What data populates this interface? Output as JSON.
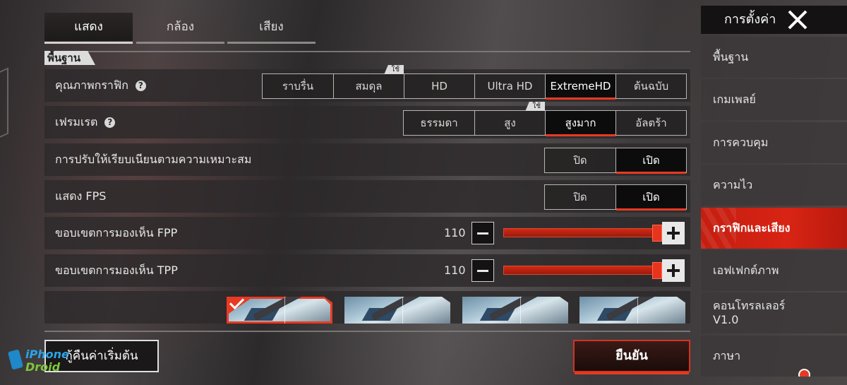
{
  "tabs": [
    {
      "label": "แสดง",
      "active": true
    },
    {
      "label": "กล้อง",
      "active": false
    },
    {
      "label": "เสียง",
      "active": false
    }
  ],
  "section": {
    "title": "พื้นฐาน"
  },
  "graphics_quality": {
    "label": "คุณภาพกราฟิก",
    "recommended_badge": "ใช้",
    "options": [
      "ราบรื่น",
      "สมดุล",
      "HD",
      "Ultra HD",
      "ExtremeHD",
      "ต้นฉบับ"
    ],
    "selected": "ExtremeHD",
    "recommended": "สมดุล"
  },
  "frame_rate": {
    "label": "เฟรมเรต",
    "recommended_badge": "ใช้",
    "options": [
      "ธรรมดา",
      "สูง",
      "สูงมาก",
      "อัลตร้า"
    ],
    "selected": "สูงมาก",
    "recommended": "สูง"
  },
  "adaptive_smooth": {
    "label": "การปรับให้เรียบเนียนตามความเหมาะสม",
    "off": "ปิด",
    "on": "เปิด",
    "selected": "เปิด"
  },
  "show_fps": {
    "label": "แสดง FPS",
    "off": "ปิด",
    "on": "เปิด",
    "selected": "เปิด"
  },
  "fpp_view": {
    "label": "ขอบเขตการมองเห็น FPP",
    "value": "110",
    "fraction": 1.0
  },
  "tpp_view": {
    "label": "ขอบเขตการมองเห็น TPP",
    "value": "110",
    "fraction": 1.0
  },
  "crosshair_presets": {
    "count": 4,
    "selected_index": 0
  },
  "buttons": {
    "reset": "กู้คืนค่าเริ่มต้น",
    "confirm": "ยืนยัน"
  },
  "watermark": {
    "line1": "iPhone",
    "line2": "Droid"
  },
  "sidebar": {
    "title": "การตั้งค่า",
    "items": [
      {
        "label": "พื้นฐาน"
      },
      {
        "label": "เกมเพลย์"
      },
      {
        "label": "การควบคุม"
      },
      {
        "label": "ความไว"
      },
      {
        "label": "กราฟิกและเสียง",
        "active": true
      },
      {
        "label": "เอฟเฟกต์ภาพ"
      },
      {
        "label": "คอนโทรลเลอร์",
        "label2": "V1.0"
      },
      {
        "label": "ภาษา"
      }
    ]
  },
  "colors": {
    "accent": "#e83a22",
    "panel": "#2d2a2b"
  }
}
